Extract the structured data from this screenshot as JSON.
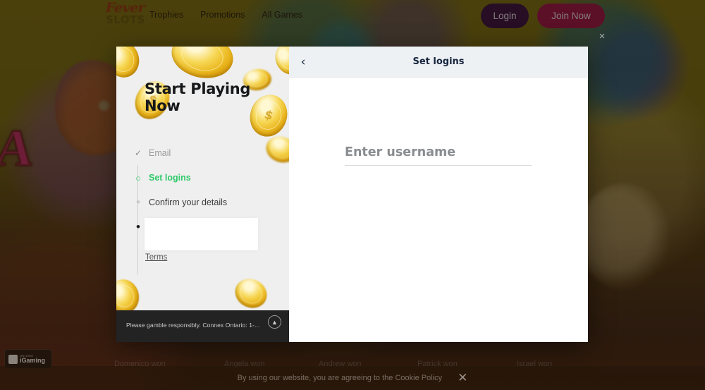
{
  "header": {
    "logo_line1": "Fever",
    "logo_line2": "SLOTS",
    "nav": [
      {
        "label": "Trophies"
      },
      {
        "label": "Promotions"
      },
      {
        "label": "All Games"
      }
    ],
    "login_label": "Login",
    "join_label": "Join Now"
  },
  "modal": {
    "close_icon": "×",
    "promo": {
      "title": "Start Playing Now",
      "coin_glyph": "$",
      "steps": [
        {
          "id": "email",
          "marker": "✓",
          "label": "Email",
          "state": "done"
        },
        {
          "id": "logins",
          "marker": "○",
          "label": "Set logins",
          "state": "active"
        },
        {
          "id": "confirm",
          "marker": "•",
          "label": "Confirm your details",
          "state": "pending"
        },
        {
          "id": "last",
          "marker": "•",
          "label": "",
          "state": "pending"
        }
      ],
      "terms_label": "Terms",
      "footer_text": "Please gamble responsibly. Connex Ontario: 1-...",
      "footer_toggle_icon": "▲"
    },
    "form": {
      "back_icon": "‹",
      "title": "Set logins",
      "username_value": "",
      "username_placeholder": "Enter username"
    }
  },
  "winners": [
    {
      "label": "Domenico won"
    },
    {
      "label": "Angela won"
    },
    {
      "label": "Andrew won"
    },
    {
      "label": "Patrick won"
    },
    {
      "label": "Israel won"
    }
  ],
  "igaming_badge": {
    "superscript": "ONTARIO",
    "name": "iGaming"
  },
  "cookie_banner": {
    "text": "By using our website, you are agreeing to the Cookie Policy",
    "close_icon": "✕"
  },
  "colors": {
    "accent_green": "#2fc96a",
    "join_pink": "#8d1340",
    "login_purple": "#34103a",
    "form_header": "#eef1f4"
  }
}
